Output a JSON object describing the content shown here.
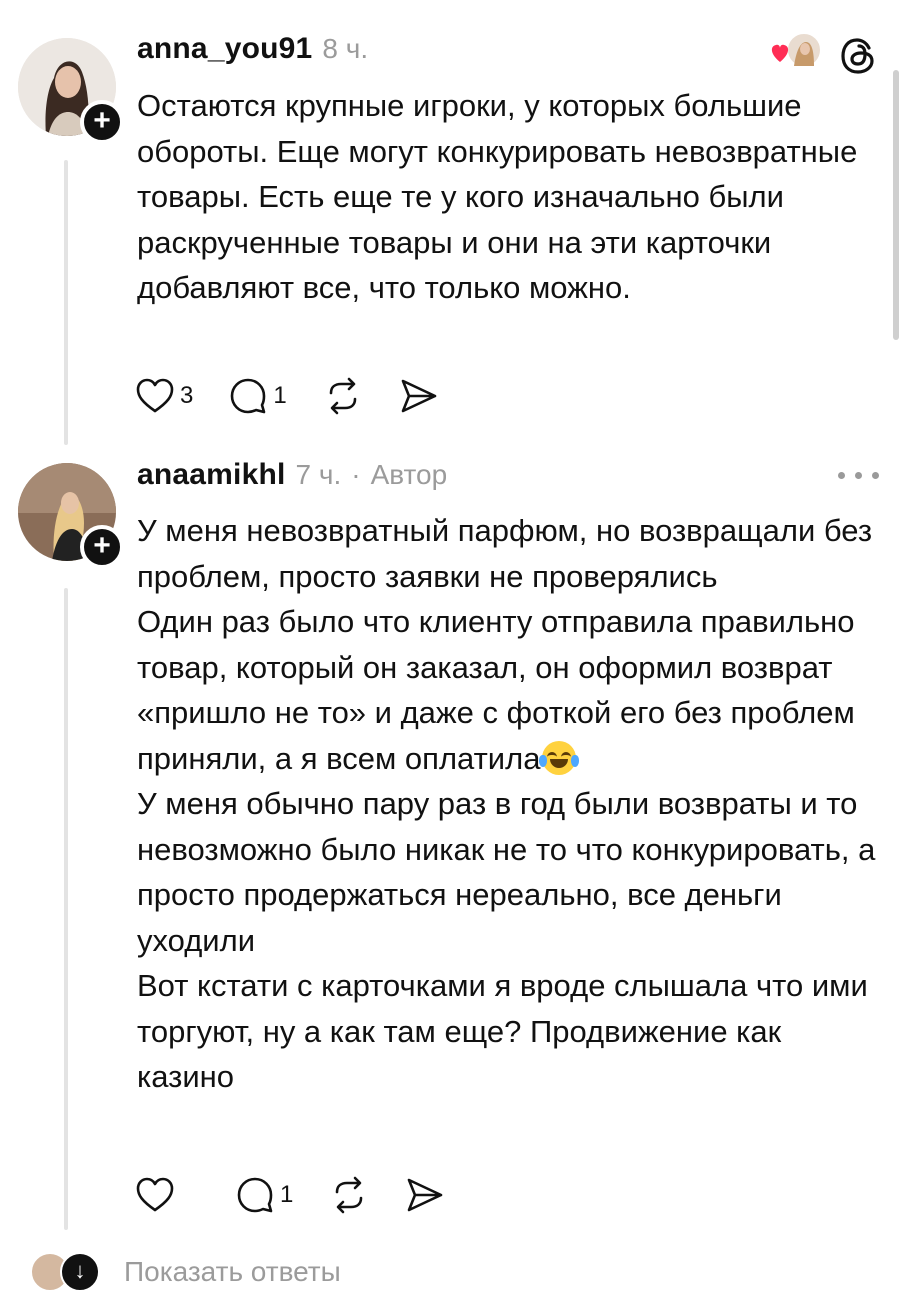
{
  "posts": [
    {
      "username": "anna_you91",
      "time": "8 ч.",
      "author_label": "",
      "paragraphs": [
        "Остаются крупные игроки, у которых большие обороты. Еще могут конкурировать невозвратные товары. Есть еще те у кого изначально были раскрученные товары и они на эти карточки добавляют все, что только можно."
      ],
      "likes": "3",
      "replies": "1"
    },
    {
      "username": "anaamikhl",
      "time": "7 ч.",
      "separator": "·",
      "author_label": "Автор",
      "paragraphs": [
        "У меня невозвратный парфюм, но возвращали без проблем, просто заявки не проверялись",
        "Один раз было что клиенту отправила правильно товар, который он заказал, он оформил возврат «пришло не то» и даже с фоткой его без проблем приняли, а я всем оплатила",
        "У меня обычно пару раз в год были возвраты и то невозможно было никак не то что конкурировать, а просто продержаться нереально, все деньги уходили",
        "Вот кстати с карточками я вроде слышала что ими торгуют, ну а как там еще? Продвижение как казино"
      ],
      "likes": "",
      "replies": "1"
    }
  ],
  "footer": {
    "show_replies": "Показать ответы"
  },
  "icons": {
    "like": "heart-icon",
    "reply": "comment-bubble-icon",
    "repost": "repost-icon",
    "share": "send-icon",
    "more": "more-dots-icon",
    "app": "threads-logo-icon",
    "emoji": "tears-of-joy-emoji"
  },
  "colors": {
    "text": "#111111",
    "muted": "#9b9b9b",
    "thread_line": "#e3e3e3",
    "like_red": "#ff2d55"
  }
}
